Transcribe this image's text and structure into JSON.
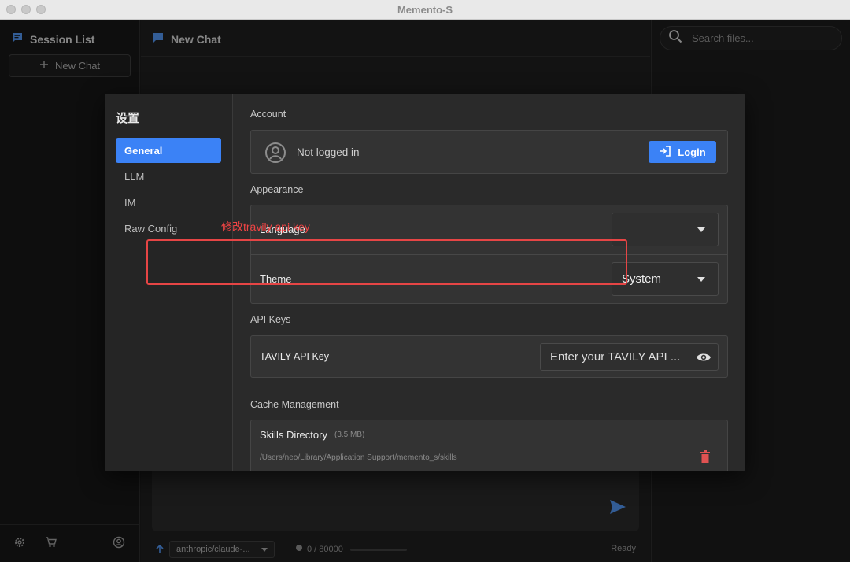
{
  "window": {
    "title": "Memento-S"
  },
  "sidebar": {
    "title": "Session List",
    "title_icon": "chat-list-icon",
    "new_chat_label": "New Chat",
    "footer_icons": [
      "gear-icon",
      "cart-icon",
      "account-icon"
    ]
  },
  "main": {
    "title": "New Chat",
    "status": {
      "model": "anthropic/claude-...",
      "tokens": "0 / 80000",
      "token_usage_fraction": 0,
      "state": "Ready"
    }
  },
  "right_panel": {
    "search_placeholder": "Search files..."
  },
  "settings": {
    "title": "设置",
    "nav": [
      "General",
      "LLM",
      "IM",
      "Raw Config"
    ],
    "active_nav": "General",
    "account": {
      "section_label": "Account",
      "status": "Not logged in",
      "login_label": "Login"
    },
    "appearance": {
      "section_label": "Appearance",
      "language_label": "Language",
      "language_value": "",
      "theme_label": "Theme",
      "theme_value": "System"
    },
    "api_keys": {
      "section_label": "API Keys",
      "annotation": "修改travily api key",
      "tavily_label": "TAVILY API Key",
      "tavily_placeholder": "Enter your TAVILY API ..."
    },
    "cache": {
      "section_label": "Cache Management",
      "skills_label": "Skills Directory",
      "skills_size": "(3.5 MB)",
      "skills_path": "/Users/neo/Library/Application Support/memento_s/skills"
    }
  },
  "colors": {
    "accent": "#3b82f6",
    "annotation": "#e64545",
    "danger": "#e05252"
  }
}
